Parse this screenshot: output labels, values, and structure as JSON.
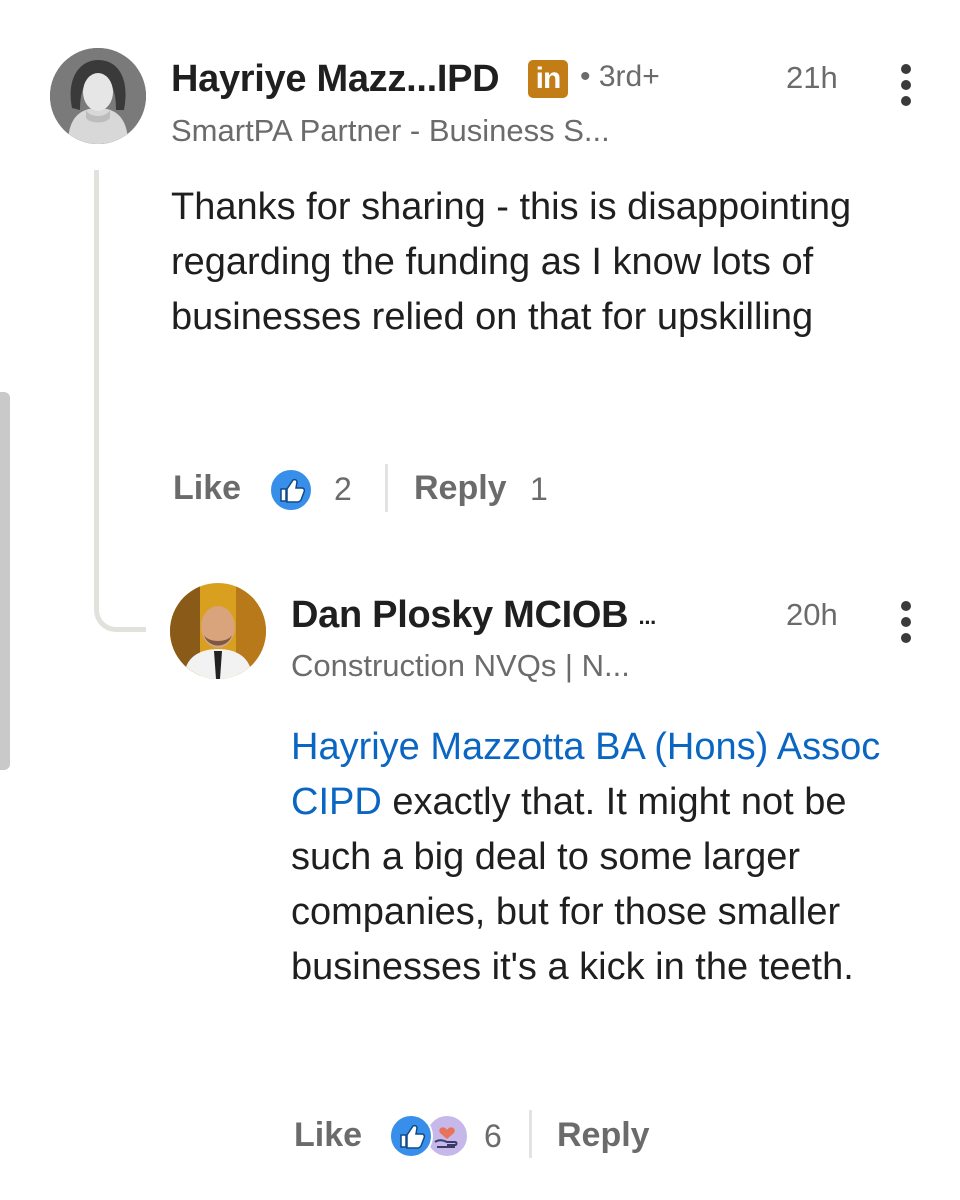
{
  "comment": {
    "author": "Hayriye Mazz...IPD",
    "badge": "in",
    "degree": "• 3rd+",
    "headline": "SmartPA Partner - Business S...",
    "time": "21h",
    "text": "Thanks for sharing - this is disappointing regarding the funding as I know lots of businesses relied on that for upskilling",
    "like_label": "Like",
    "reaction_count": "2",
    "reply_label": "Reply",
    "reply_count": "1",
    "reactions": [
      "like-icon"
    ]
  },
  "reply": {
    "author": "Dan Plosky MCIOB",
    "author_ellipsis": "...",
    "headline": "Construction NVQs | N...",
    "time": "20h",
    "mention": "Hayriye Mazzotta BA (Hons) Assoc CIPD",
    "text": " exactly that. It might not be such a big deal to some larger companies, but for those smaller businesses it's a kick in the teeth.",
    "like_label": "Like",
    "reaction_count": "6",
    "reply_label": "Reply",
    "reactions": [
      "like-icon",
      "support-icon"
    ]
  },
  "colors": {
    "mention": "#0a66c2",
    "like_icon": "#378fe9",
    "linkedin_badge": "#c37d16",
    "support_icon": "#c7b8ea"
  }
}
